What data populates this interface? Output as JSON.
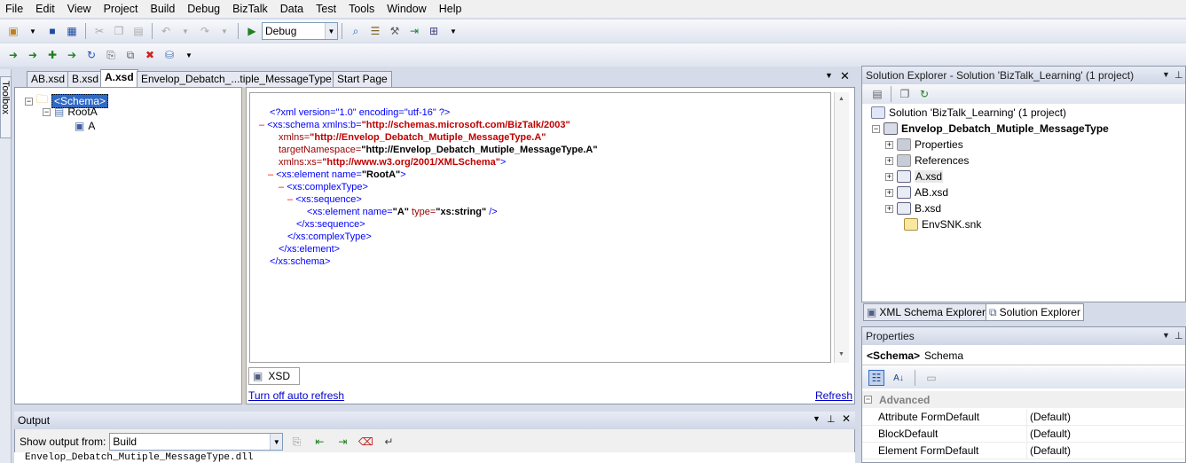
{
  "menu": [
    "File",
    "Edit",
    "View",
    "Project",
    "Build",
    "Debug",
    "BizTalk",
    "Data",
    "Test",
    "Tools",
    "Window",
    "Help"
  ],
  "toolbar": {
    "config_value": "Debug"
  },
  "toolbox_label": "Toolbox",
  "doc_tabs": [
    "AB.xsd",
    "B.xsd",
    "A.xsd",
    "Envelop_Debatch_...tiple_MessageType",
    "Start Page"
  ],
  "tree": {
    "root": "<Schema>",
    "record": "RootA",
    "field": "A"
  },
  "xml": {
    "l1": "<?xml version=\"1.0\" encoding=\"utf-16\" ?>",
    "l2_tag": "<xs:schema xmlns:b=",
    "l2_val": "\"http://schemas.microsoft.com/BizTalk/2003\"",
    "l3_attr": "xmlns=",
    "l3_val": "\"http://Envelop_Debatch_Mutiple_MessageType.A\"",
    "l4_attr": "targetNamespace=",
    "l4_val": "\"http://Envelop_Debatch_Mutiple_MessageType.A\"",
    "l5_attr": "xmlns:xs=",
    "l5_val": "\"http://www.w3.org/2001/XMLSchema\"",
    "l5_end": ">",
    "l6_tag": "<xs:element name=",
    "l6_val": "\"RootA\"",
    "l6_end": ">",
    "l7": "<xs:complexType>",
    "l8": "<xs:sequence>",
    "l9_tag": "<xs:element name=",
    "l9_val": "\"A\"",
    "l9_attr": " type=",
    "l9_val2": "\"xs:string\"",
    "l9_end": " />",
    "l10": "</xs:sequence>",
    "l11": "</xs:complexType>",
    "l12": "</xs:element>",
    "l13": "</xs:schema>"
  },
  "view_tab": "XSD",
  "auto_refresh_link": "Turn off auto refresh",
  "refresh_link": "Refresh",
  "output": {
    "title": "Output",
    "show_from_label": "Show output from:",
    "source": "Build",
    "first_line": "Envelop_Debatch_Mutiple_MessageType.dll"
  },
  "solution_explorer": {
    "title": "Solution Explorer - Solution 'BizTalk_Learning' (1 project)",
    "solution": "Solution 'BizTalk_Learning' (1 project)",
    "project": "Envelop_Debatch_Mutiple_MessageType",
    "items": [
      "Properties",
      "References",
      "A.xsd",
      "AB.xsd",
      "B.xsd",
      "EnvSNK.snk"
    ],
    "tabs": [
      "XML Schema Explorer",
      "Solution Explorer"
    ]
  },
  "properties": {
    "title": "Properties",
    "object_bold": "<Schema>",
    "object_type": "Schema",
    "category": "Advanced",
    "rows": [
      {
        "name": "Attribute FormDefault",
        "value": "(Default)"
      },
      {
        "name": "BlockDefault",
        "value": "(Default)"
      },
      {
        "name": "Element FormDefault",
        "value": "(Default)"
      }
    ]
  },
  "colors": {
    "link": "#0000cc",
    "xml_tag": "#0000ff",
    "xml_value": "#990000",
    "selection": "#316ac5"
  }
}
